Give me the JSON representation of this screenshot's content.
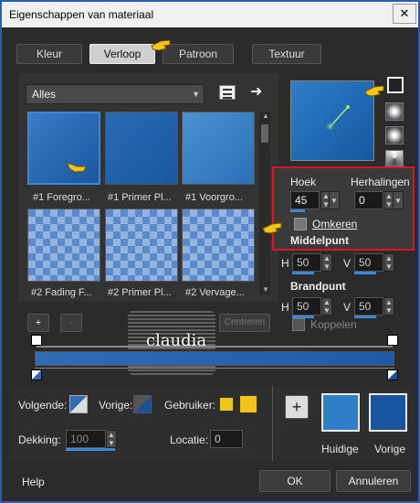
{
  "window": {
    "title": "Eigenschappen van materiaal",
    "close_symbol": "✕"
  },
  "tabs": [
    {
      "label": "Kleur"
    },
    {
      "label": "Verloop"
    },
    {
      "label": "Patroon"
    },
    {
      "label": "Textuur"
    }
  ],
  "library": {
    "dropdown_value": "Alles",
    "thumbnails": [
      {
        "label": "#1 Foregro..."
      },
      {
        "label": "#1 Primer Pl..."
      },
      {
        "label": "#1 Voorgro..."
      },
      {
        "label": "#2 Fading F..."
      },
      {
        "label": "#2 Primer Pl..."
      },
      {
        "label": "#2 Vervage..."
      }
    ]
  },
  "gradient_editor": {
    "add": "+",
    "remove": "-",
    "center_button": "Centreren",
    "watermark": "claudia"
  },
  "settings": {
    "hoek_label": "Hoek",
    "hoek_value": "45",
    "herhalingen_label": "Herhalingen",
    "herhalingen_value": "0",
    "omkeren_label": "Omkeren",
    "middelpunt_label": "Middelpunt",
    "h_label": "H",
    "v_label": "V",
    "h_value": "50",
    "v_value": "50",
    "brandpunt_label": "Brandpunt",
    "h2_value": "50",
    "v2_value": "50",
    "koppelen_label": "Koppelen"
  },
  "bottom": {
    "volgende_label": "Volgende:",
    "vorige_label": "Vorige:",
    "gebruiker_label": "Gebruiker:",
    "dekking_label": "Dekking:",
    "dekking_value": "100",
    "locatie_label": "Locatie:",
    "locatie_value": "0",
    "huidige_label": "Huidige",
    "vorige_swatch_label": "Vorige",
    "plus": "+"
  },
  "footer": {
    "help": "Help",
    "ok": "OK",
    "cancel": "Annuleren"
  },
  "colors": {
    "accent_blue": "#2f6db5",
    "dark_blue": "#1a4f9a",
    "user_yellow": "#f0c419",
    "highlight_red": "#e0141e"
  }
}
